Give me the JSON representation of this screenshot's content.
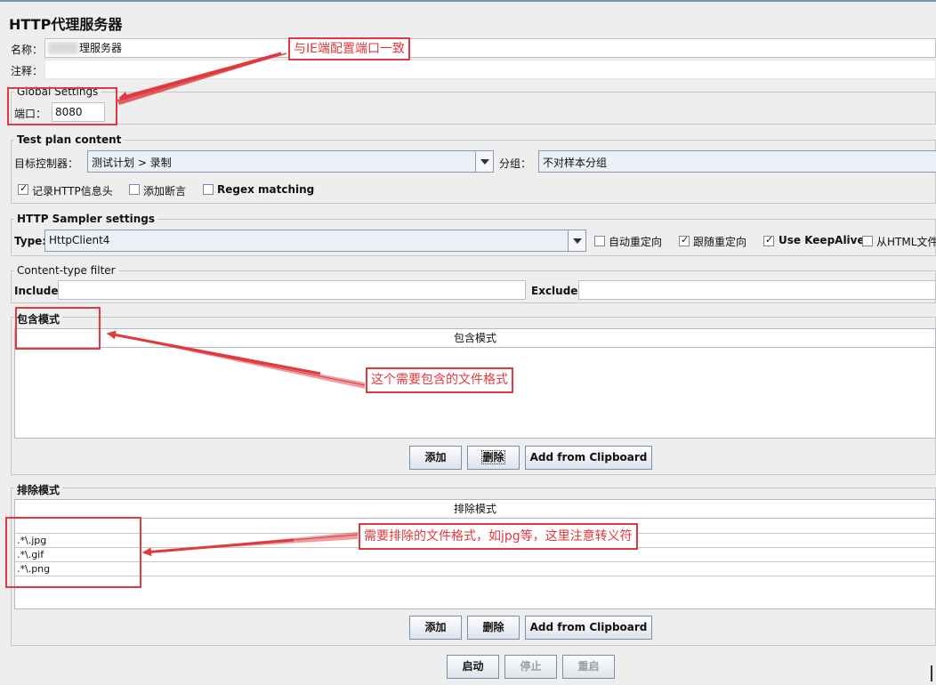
{
  "window": {
    "title": "HTTP代理服务器"
  },
  "name_row": {
    "label": "名称：",
    "value": "理服务器"
  },
  "comment_row": {
    "label": "注释：",
    "value": ""
  },
  "global_settings": {
    "legend": "Global Settings",
    "port_label": "端口：",
    "port_value": "8080"
  },
  "test_plan": {
    "legend": "Test plan content",
    "target_label": "目标控制器：",
    "target_value": "测试计划 > 录制",
    "group_label": "分组：",
    "group_value": "不对样本分组",
    "options": [
      {
        "label": "记录HTTP信息头",
        "checked": true
      },
      {
        "label": "添加断言",
        "checked": false
      },
      {
        "label": "Regex matching",
        "checked": false
      }
    ]
  },
  "sampler": {
    "legend": "HTTP Sampler settings",
    "type_label": "Type:",
    "type_value": "HttpClient4",
    "options": [
      {
        "label": "自动重定向",
        "checked": false
      },
      {
        "label": "跟随重定向",
        "checked": true
      },
      {
        "label": "Use KeepAlive",
        "checked": true
      },
      {
        "label": "从HTML文件",
        "checked": false
      }
    ]
  },
  "content_filter": {
    "legend": "Content-type filter",
    "include_label": "Include:",
    "exclude_label": "Exclude:"
  },
  "include_patterns": {
    "legend": "包含模式",
    "column": "包含模式",
    "rows": [],
    "buttons": {
      "add": "添加",
      "delete": "删除",
      "clipboard": "Add from Clipboard"
    }
  },
  "exclude_patterns": {
    "legend": "排除模式",
    "column": "排除模式",
    "rows": [
      ".*\\.jpg",
      ".*\\.gif",
      ".*\\.png"
    ],
    "buttons": {
      "add": "添加",
      "delete": "删除",
      "clipboard": "Add from Clipboard"
    }
  },
  "controls": {
    "start": "启动",
    "stop": "停止",
    "restart": "重启"
  },
  "annotations": {
    "port_note": "与IE端配置端口一致",
    "include_note": "这个需要包含的文件格式",
    "exclude_note": "需要排除的文件格式，如jpg等，这里注意转义符"
  },
  "colors": {
    "annotation_red": "#e0393e",
    "panel_bg": "#eeeeee"
  }
}
